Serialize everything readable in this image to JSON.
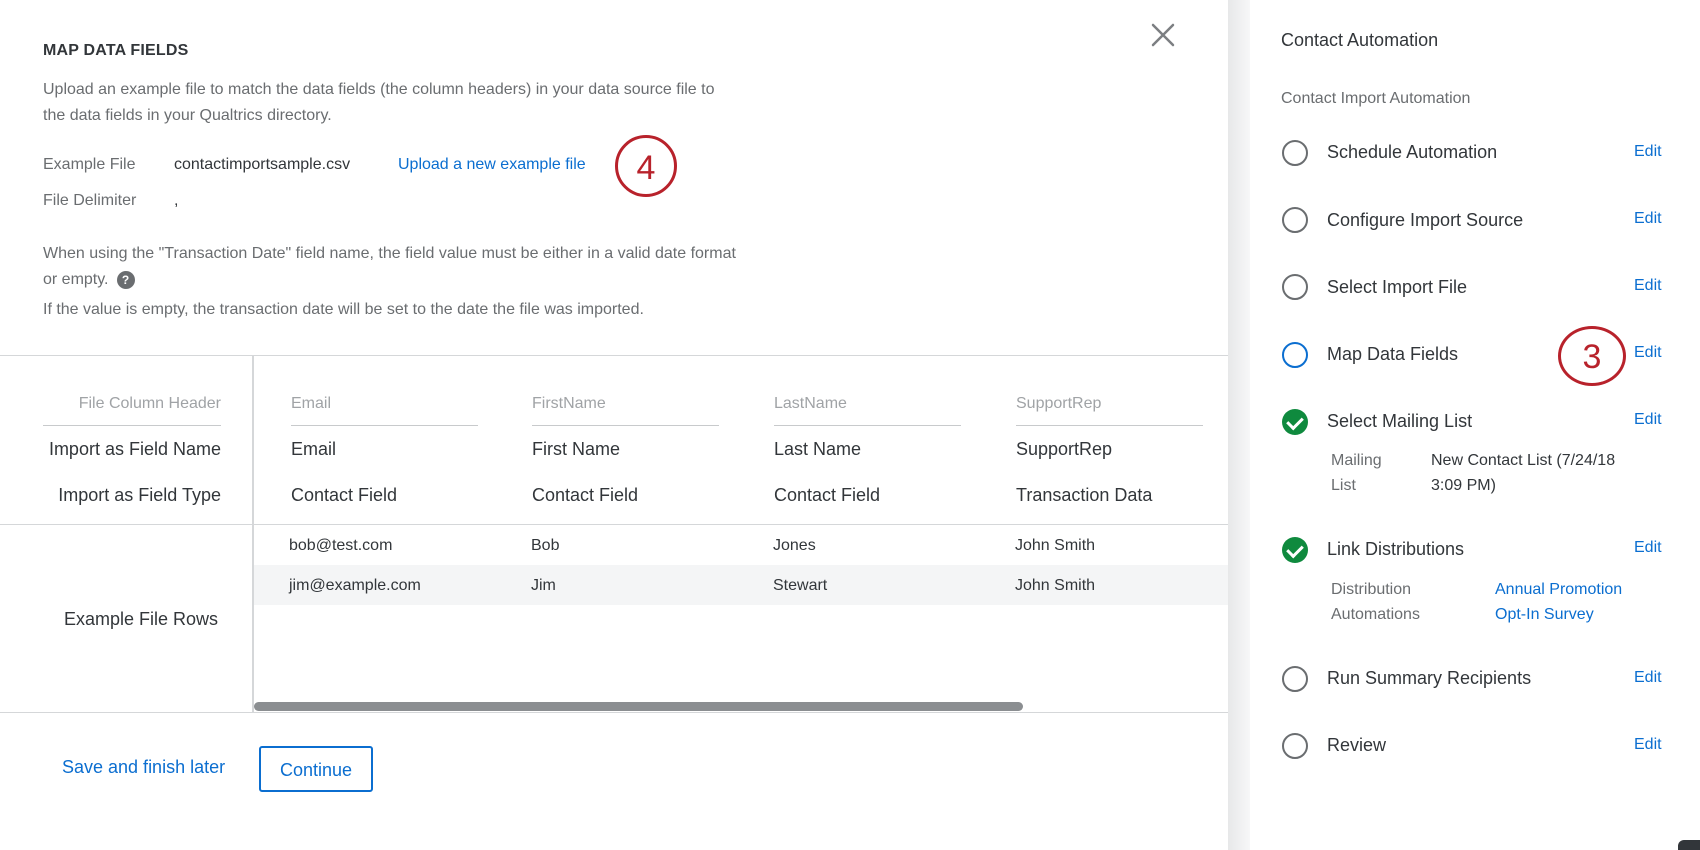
{
  "main": {
    "title": "MAP DATA FIELDS",
    "description": "Upload an example file to match the data fields (the column headers) in your data source file to the data fields in your Qualtrics directory.",
    "example_file_label": "Example File",
    "example_file_value": "contactimportsample.csv",
    "upload_link": "Upload a new example file",
    "delimiter_label": "File Delimiter",
    "delimiter_value": ",",
    "note_line1": "When using the \"Transaction Date\" field name, the field value must be either in a valid date format or empty.",
    "help_glyph": "?",
    "note_line2": "If the value is empty, the transaction date will be set to the date the file was imported.",
    "marker": "4"
  },
  "table": {
    "row_labels": {
      "column_header": "File Column Header",
      "field_name": "Import as Field Name",
      "field_type": "Import as Field Type",
      "example_rows": "Example File Rows"
    },
    "columns": [
      {
        "header": "Email",
        "field_name": "Email",
        "field_type": "Contact Field"
      },
      {
        "header": "FirstName",
        "field_name": "First Name",
        "field_type": "Contact Field"
      },
      {
        "header": "LastName",
        "field_name": "Last Name",
        "field_type": "Contact Field"
      },
      {
        "header": "SupportRep",
        "field_name": "SupportRep",
        "field_type": "Transaction Data"
      }
    ],
    "rows": [
      [
        "bob@test.com",
        "Bob",
        "Jones",
        "John Smith"
      ],
      [
        "jim@example.com",
        "Jim",
        "Stewart",
        "John Smith"
      ]
    ]
  },
  "footer": {
    "save_later": "Save and finish later",
    "continue": "Continue"
  },
  "sidebar": {
    "title": "Contact Automation",
    "subtitle": "Contact Import Automation",
    "edit_label": "Edit",
    "steps": [
      {
        "label": "Schedule Automation",
        "state": "pending"
      },
      {
        "label": "Configure Import Source",
        "state": "pending"
      },
      {
        "label": "Select Import File",
        "state": "pending"
      },
      {
        "label": "Map Data Fields",
        "state": "active"
      },
      {
        "label": "Select Mailing List",
        "state": "done"
      },
      {
        "label": "Link Distributions",
        "state": "done"
      },
      {
        "label": "Run Summary Recipients",
        "state": "pending"
      },
      {
        "label": "Review",
        "state": "pending"
      }
    ],
    "mailing": {
      "label_line1": "Mailing",
      "label_line2": "List",
      "value_line1": "New Contact List (7/24/18",
      "value_line2": "3:09 PM)"
    },
    "distribution": {
      "label_line1": "Distribution",
      "label_line2": "Automations",
      "links": [
        "Annual Promotion",
        "Opt-In Survey"
      ]
    },
    "marker": "3"
  },
  "colors": {
    "accent": "#0b6ed0",
    "success": "#0f8a3e",
    "marker": "#b8222b"
  }
}
